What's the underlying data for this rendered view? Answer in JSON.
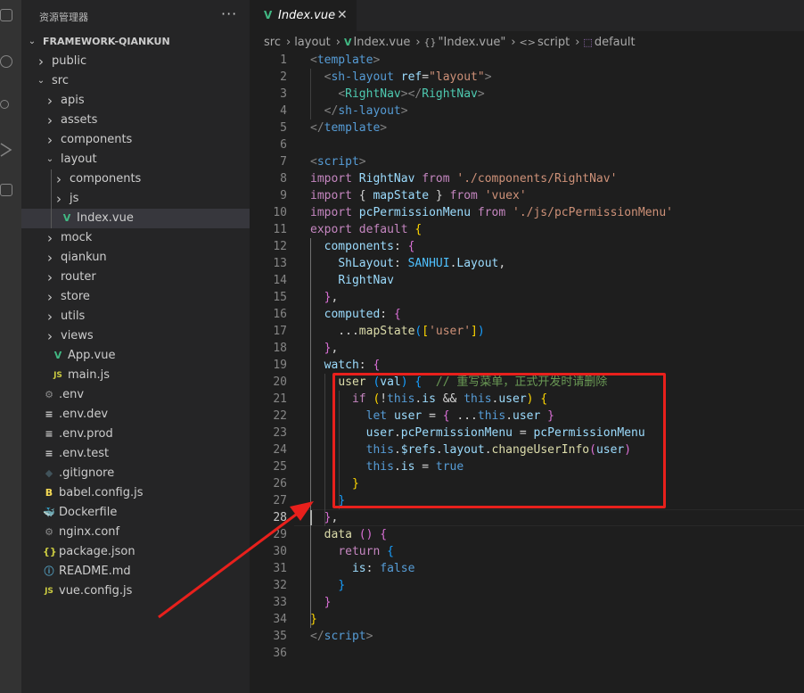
{
  "sidebar": {
    "title": "资源管理器",
    "more": "···",
    "tree": [
      {
        "label": "FRAMEWORK-QIANKUN",
        "depth": 0,
        "twist": "down",
        "icon": "",
        "root": true
      },
      {
        "label": "public",
        "depth": 1,
        "twist": "right",
        "icon": ""
      },
      {
        "label": "src",
        "depth": 1,
        "twist": "down",
        "icon": ""
      },
      {
        "label": "apis",
        "depth": 2,
        "twist": "right",
        "icon": ""
      },
      {
        "label": "assets",
        "depth": 2,
        "twist": "right",
        "icon": ""
      },
      {
        "label": "components",
        "depth": 2,
        "twist": "right",
        "icon": ""
      },
      {
        "label": "layout",
        "depth": 2,
        "twist": "down",
        "icon": ""
      },
      {
        "label": "components",
        "depth": 3,
        "twist": "right",
        "icon": ""
      },
      {
        "label": "js",
        "depth": 3,
        "twist": "right",
        "icon": ""
      },
      {
        "label": "Index.vue",
        "depth": 3,
        "twist": "",
        "icon": "vue",
        "selected": true
      },
      {
        "label": "mock",
        "depth": 2,
        "twist": "right",
        "icon": ""
      },
      {
        "label": "qiankun",
        "depth": 2,
        "twist": "right",
        "icon": ""
      },
      {
        "label": "router",
        "depth": 2,
        "twist": "right",
        "icon": ""
      },
      {
        "label": "store",
        "depth": 2,
        "twist": "right",
        "icon": ""
      },
      {
        "label": "utils",
        "depth": 2,
        "twist": "right",
        "icon": ""
      },
      {
        "label": "views",
        "depth": 2,
        "twist": "right",
        "icon": ""
      },
      {
        "label": "App.vue",
        "depth": 2,
        "twist": "",
        "icon": "vue"
      },
      {
        "label": "main.js",
        "depth": 2,
        "twist": "",
        "icon": "js"
      },
      {
        "label": ".env",
        "depth": 1,
        "twist": "",
        "icon": "gear"
      },
      {
        "label": ".env.dev",
        "depth": 1,
        "twist": "",
        "icon": "lines"
      },
      {
        "label": ".env.prod",
        "depth": 1,
        "twist": "",
        "icon": "lines"
      },
      {
        "label": ".env.test",
        "depth": 1,
        "twist": "",
        "icon": "lines"
      },
      {
        "label": ".gitignore",
        "depth": 1,
        "twist": "",
        "icon": "git"
      },
      {
        "label": "babel.config.js",
        "depth": 1,
        "twist": "",
        "icon": "babel"
      },
      {
        "label": "Dockerfile",
        "depth": 1,
        "twist": "",
        "icon": "docker"
      },
      {
        "label": "nginx.conf",
        "depth": 1,
        "twist": "",
        "icon": "gear"
      },
      {
        "label": "package.json",
        "depth": 1,
        "twist": "",
        "icon": "json"
      },
      {
        "label": "README.md",
        "depth": 1,
        "twist": "",
        "icon": "info"
      },
      {
        "label": "vue.config.js",
        "depth": 1,
        "twist": "",
        "icon": "js"
      }
    ]
  },
  "icons": {
    "vue": "V",
    "js": "JS",
    "gear": "⚙",
    "lines": "≡",
    "git": "◆",
    "babel": "B",
    "docker": "🐳",
    "json": "{}",
    "info": "ⓘ"
  },
  "tab": {
    "name": "Index.vue",
    "close": "✕",
    "icon": "V"
  },
  "breadcrumb": [
    {
      "text": "src",
      "kind": "plain"
    },
    {
      "text": "layout",
      "kind": "plain"
    },
    {
      "text": "Index.vue",
      "kind": "vue"
    },
    {
      "text": "\"Index.vue\"",
      "kind": "braces"
    },
    {
      "text": "script",
      "kind": "tag"
    },
    {
      "text": "default",
      "kind": "cube"
    }
  ],
  "breadcrumb_icons": {
    "braces": "{}",
    "tag": "<>",
    "cube": "⬚",
    "sep": "›"
  },
  "current_line": 28,
  "code": [
    [
      [
        "t-ang",
        "<"
      ],
      [
        "t-tag",
        "template"
      ],
      [
        "t-ang",
        ">"
      ]
    ],
    [
      [
        "t-punc",
        "  "
      ],
      [
        "t-ang",
        "<"
      ],
      [
        "t-tag",
        "sh-layout"
      ],
      [
        "t-punc",
        " "
      ],
      [
        "t-attr",
        "ref"
      ],
      [
        "t-punc",
        "="
      ],
      [
        "t-str",
        "\"layout\""
      ],
      [
        "t-ang",
        ">"
      ]
    ],
    [
      [
        "t-punc",
        "    "
      ],
      [
        "t-ang",
        "<"
      ],
      [
        "t-comp",
        "RightNav"
      ],
      [
        "t-ang",
        "></"
      ],
      [
        "t-comp",
        "RightNav"
      ],
      [
        "t-ang",
        ">"
      ]
    ],
    [
      [
        "t-punc",
        "  "
      ],
      [
        "t-ang",
        "</"
      ],
      [
        "t-tag",
        "sh-layout"
      ],
      [
        "t-ang",
        ">"
      ]
    ],
    [
      [
        "t-ang",
        "</"
      ],
      [
        "t-tag",
        "template"
      ],
      [
        "t-ang",
        ">"
      ]
    ],
    [],
    [
      [
        "t-ang",
        "<"
      ],
      [
        "t-tag",
        "script"
      ],
      [
        "t-ang",
        ">"
      ]
    ],
    [
      [
        "t-kw",
        "import"
      ],
      [
        "t-punc",
        " "
      ],
      [
        "t-var",
        "RightNav"
      ],
      [
        "t-punc",
        " "
      ],
      [
        "t-kw",
        "from"
      ],
      [
        "t-punc",
        " "
      ],
      [
        "t-str",
        "'./components/RightNav'"
      ]
    ],
    [
      [
        "t-kw",
        "import"
      ],
      [
        "t-punc",
        " { "
      ],
      [
        "t-var",
        "mapState"
      ],
      [
        "t-punc",
        " } "
      ],
      [
        "t-kw",
        "from"
      ],
      [
        "t-punc",
        " "
      ],
      [
        "t-str",
        "'vuex'"
      ]
    ],
    [
      [
        "t-kw",
        "import"
      ],
      [
        "t-punc",
        " "
      ],
      [
        "t-var",
        "pcPermissionMenu"
      ],
      [
        "t-punc",
        " "
      ],
      [
        "t-kw",
        "from"
      ],
      [
        "t-punc",
        " "
      ],
      [
        "t-str",
        "'./js/pcPermissionMenu'"
      ]
    ],
    [
      [
        "t-kw",
        "export"
      ],
      [
        "t-punc",
        " "
      ],
      [
        "t-kw",
        "default"
      ],
      [
        "t-punc",
        " "
      ],
      [
        "t-br",
        "{"
      ]
    ],
    [
      [
        "t-punc",
        "  "
      ],
      [
        "t-var",
        "components"
      ],
      [
        "t-punc",
        ": "
      ],
      [
        "t-br2",
        "{"
      ]
    ],
    [
      [
        "t-punc",
        "    "
      ],
      [
        "t-var",
        "ShLayout"
      ],
      [
        "t-punc",
        ": "
      ],
      [
        "t-const",
        "SANHUI"
      ],
      [
        "t-punc",
        "."
      ],
      [
        "t-var",
        "Layout"
      ],
      [
        "t-punc",
        ","
      ]
    ],
    [
      [
        "t-punc",
        "    "
      ],
      [
        "t-var",
        "RightNav"
      ]
    ],
    [
      [
        "t-punc",
        "  "
      ],
      [
        "t-br2",
        "}"
      ],
      [
        "t-punc",
        ","
      ]
    ],
    [
      [
        "t-punc",
        "  "
      ],
      [
        "t-var",
        "computed"
      ],
      [
        "t-punc",
        ": "
      ],
      [
        "t-br2",
        "{"
      ]
    ],
    [
      [
        "t-punc",
        "    ..."
      ],
      [
        "t-fn",
        "mapState"
      ],
      [
        "t-br3",
        "("
      ],
      [
        "t-br",
        "["
      ],
      [
        "t-str",
        "'user'"
      ],
      [
        "t-br",
        "]"
      ],
      [
        "t-br3",
        ")"
      ]
    ],
    [
      [
        "t-punc",
        "  "
      ],
      [
        "t-br2",
        "}"
      ],
      [
        "t-punc",
        ","
      ]
    ],
    [
      [
        "t-punc",
        "  "
      ],
      [
        "t-var",
        "watch"
      ],
      [
        "t-punc",
        ": "
      ],
      [
        "t-br2",
        "{"
      ]
    ],
    [
      [
        "t-punc",
        "    "
      ],
      [
        "t-fn",
        "user"
      ],
      [
        "t-punc",
        " "
      ],
      [
        "t-br3",
        "("
      ],
      [
        "t-var",
        "val"
      ],
      [
        "t-br3",
        ")"
      ],
      [
        "t-punc",
        " "
      ],
      [
        "t-br3",
        "{"
      ],
      [
        "t-punc",
        "  "
      ],
      [
        "t-com",
        "// 重写菜单，正式开发时请删除"
      ]
    ],
    [
      [
        "t-punc",
        "      "
      ],
      [
        "t-kw",
        "if"
      ],
      [
        "t-punc",
        " "
      ],
      [
        "t-br",
        "("
      ],
      [
        "t-punc",
        "!"
      ],
      [
        "t-blue",
        "this"
      ],
      [
        "t-punc",
        "."
      ],
      [
        "t-var",
        "is"
      ],
      [
        "t-punc",
        " && "
      ],
      [
        "t-blue",
        "this"
      ],
      [
        "t-punc",
        "."
      ],
      [
        "t-var",
        "user"
      ],
      [
        "t-br",
        ")"
      ],
      [
        "t-punc",
        " "
      ],
      [
        "t-br",
        "{"
      ]
    ],
    [
      [
        "t-punc",
        "        "
      ],
      [
        "t-blue",
        "let"
      ],
      [
        "t-punc",
        " "
      ],
      [
        "t-var",
        "user"
      ],
      [
        "t-punc",
        " = "
      ],
      [
        "t-br2",
        "{"
      ],
      [
        "t-punc",
        " ..."
      ],
      [
        "t-blue",
        "this"
      ],
      [
        "t-punc",
        "."
      ],
      [
        "t-var",
        "user"
      ],
      [
        "t-punc",
        " "
      ],
      [
        "t-br2",
        "}"
      ]
    ],
    [
      [
        "t-punc",
        "        "
      ],
      [
        "t-var",
        "user"
      ],
      [
        "t-punc",
        "."
      ],
      [
        "t-var",
        "pcPermissionMenu"
      ],
      [
        "t-punc",
        " = "
      ],
      [
        "t-var",
        "pcPermissionMenu"
      ]
    ],
    [
      [
        "t-punc",
        "        "
      ],
      [
        "t-blue",
        "this"
      ],
      [
        "t-punc",
        "."
      ],
      [
        "t-var",
        "$refs"
      ],
      [
        "t-punc",
        "."
      ],
      [
        "t-var",
        "layout"
      ],
      [
        "t-punc",
        "."
      ],
      [
        "t-fn",
        "changeUserInfo"
      ],
      [
        "t-br2",
        "("
      ],
      [
        "t-var",
        "user"
      ],
      [
        "t-br2",
        ")"
      ]
    ],
    [
      [
        "t-punc",
        "        "
      ],
      [
        "t-blue",
        "this"
      ],
      [
        "t-punc",
        "."
      ],
      [
        "t-var",
        "is"
      ],
      [
        "t-punc",
        " = "
      ],
      [
        "t-blue",
        "true"
      ]
    ],
    [
      [
        "t-punc",
        "      "
      ],
      [
        "t-br",
        "}"
      ]
    ],
    [
      [
        "t-punc",
        "    "
      ],
      [
        "t-br3",
        "}"
      ]
    ],
    [
      [
        "t-punc",
        "  "
      ],
      [
        "t-br2",
        "}"
      ],
      [
        "t-punc",
        ","
      ]
    ],
    [
      [
        "t-punc",
        "  "
      ],
      [
        "t-fn",
        "data"
      ],
      [
        "t-punc",
        " "
      ],
      [
        "t-br2",
        "("
      ],
      [
        "t-br2",
        ")"
      ],
      [
        "t-punc",
        " "
      ],
      [
        "t-br2",
        "{"
      ]
    ],
    [
      [
        "t-punc",
        "    "
      ],
      [
        "t-kw",
        "return"
      ],
      [
        "t-punc",
        " "
      ],
      [
        "t-br3",
        "{"
      ]
    ],
    [
      [
        "t-punc",
        "      "
      ],
      [
        "t-var",
        "is"
      ],
      [
        "t-punc",
        ": "
      ],
      [
        "t-blue",
        "false"
      ]
    ],
    [
      [
        "t-punc",
        "    "
      ],
      [
        "t-br3",
        "}"
      ]
    ],
    [
      [
        "t-punc",
        "  "
      ],
      [
        "t-br2",
        "}"
      ]
    ],
    [
      [
        "t-br",
        "}"
      ]
    ],
    [
      [
        "t-ang",
        "</"
      ],
      [
        "t-tag",
        "script"
      ],
      [
        "t-ang",
        ">"
      ]
    ],
    []
  ],
  "annotation": {
    "box_color": "#e8201c",
    "arrow_color": "#e8201c"
  }
}
